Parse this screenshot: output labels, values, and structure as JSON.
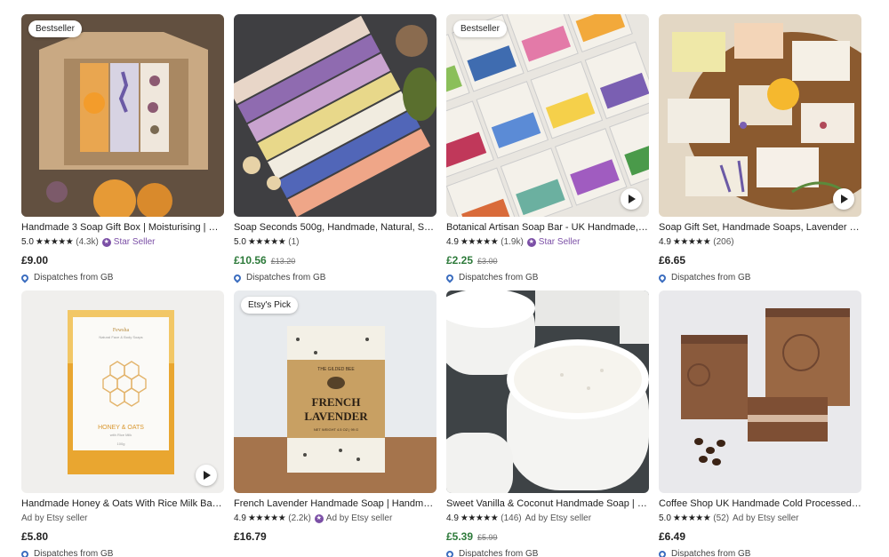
{
  "listings": [
    {
      "badge": "Bestseller",
      "title": "Handmade 3 Soap Gift Box | Moisturising | Eco...",
      "rating": "5.0",
      "stars": "★★★★★",
      "reviews": "(4.3k)",
      "tag": "Star Seller",
      "price": "£9.00",
      "old_price": "",
      "dispatch": "Dispatches from GB",
      "video": false
    },
    {
      "badge": "",
      "title": "Soap Seconds 500g, Handmade, Natural, Sen...",
      "rating": "5.0",
      "stars": "★★★★★",
      "reviews": "(1)",
      "tag": "",
      "price": "£10.56",
      "old_price": "£13.20",
      "dispatch": "Dispatches from GB",
      "video": false
    },
    {
      "badge": "Bestseller",
      "title": "Botanical Artisan Soap Bar - UK Handmade, N...",
      "rating": "4.9",
      "stars": "★★★★★",
      "reviews": "(1.9k)",
      "tag": "Star Seller",
      "price": "£2.25",
      "old_price": "£3.00",
      "dispatch": "Dispatches from GB",
      "video": true
    },
    {
      "badge": "",
      "title": "Soap Gift Set, Handmade Soaps, Lavender So...",
      "rating": "4.9",
      "stars": "★★★★★",
      "reviews": "(206)",
      "tag": "",
      "price": "£6.65",
      "old_price": "",
      "dispatch": "Dispatches from GB",
      "video": true
    },
    {
      "badge": "",
      "title": "Handmade Honey & Oats With Rice Milk Bar S...",
      "ad": "Ad by Etsy seller",
      "price": "£5.80",
      "old_price": "",
      "dispatch": "Dispatches from GB",
      "video": true,
      "label_brand": "Fewsha",
      "label_line": "Natural Face & Body Soaps",
      "label_name": "HONEY & OATS",
      "label_sub": "with Rice Milk",
      "label_weight": "100g"
    },
    {
      "badge": "Etsy's Pick",
      "title": "French Lavender Handmade Soap | Handmad...",
      "rating": "4.9",
      "stars": "★★★★★",
      "reviews": "(2.2k)",
      "tag": "Ad by Etsy seller",
      "price": "£16.79",
      "old_price": "",
      "dispatch": "",
      "video": false,
      "label_brand": "THE GILDED BEE",
      "label_name1": "FRENCH",
      "label_name2": "LAVENDER",
      "label_weight": "NET WEIGHT 4.5 OZ | 99 G"
    },
    {
      "badge": "",
      "title": "Sweet Vanilla & Coconut Handmade Soap | Ba...",
      "rating": "4.9",
      "stars": "★★★★★",
      "reviews": "(146)",
      "tag": "Ad by Etsy seller",
      "price": "£5.39",
      "old_price": "£5.99",
      "dispatch": "Dispatches from GB",
      "video": false
    },
    {
      "badge": "",
      "title": "Coffee Shop UK Handmade Cold Processed S...",
      "rating": "5.0",
      "stars": "★★★★★",
      "reviews": "(52)",
      "tag": "Ad by Etsy seller",
      "price": "£6.49",
      "old_price": "",
      "dispatch": "Dispatches from GB",
      "video": false
    }
  ],
  "colors": {
    "sale_price": "#2d7a3a",
    "star_seller": "#7b4fa6",
    "pin": "#3b6dbf"
  }
}
